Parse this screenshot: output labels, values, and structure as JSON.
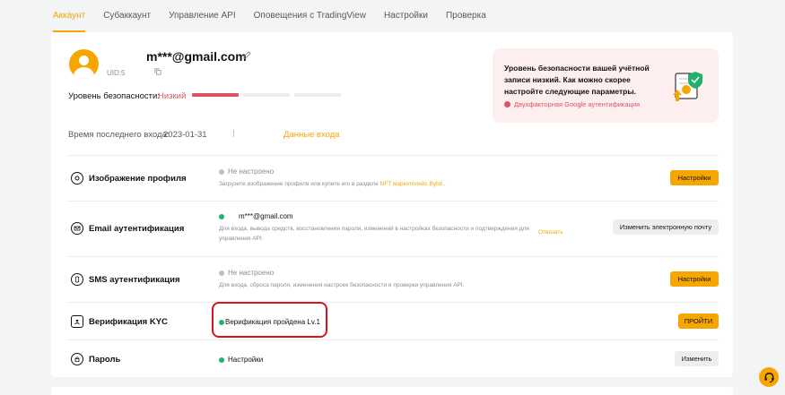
{
  "tabs": [
    {
      "label": "Аккаунт",
      "active": true
    },
    {
      "label": "Субаккаунт",
      "active": false
    },
    {
      "label": "Управление API",
      "active": false
    },
    {
      "label": "Оповещения с TradingView",
      "active": false
    },
    {
      "label": "Настройки",
      "active": false
    },
    {
      "label": "Проверка",
      "active": false
    }
  ],
  "profile": {
    "email": "m***@gmail.com",
    "uid": "UID:5",
    "security_label": "Уровень безопасности:",
    "security_value": "Низкий",
    "security_level_filled": 1,
    "security_level_total": 3,
    "last_login_label": "Время последнего входа:",
    "last_login_date": "2023-01-31",
    "login_data_link": "Данные входа"
  },
  "alert": {
    "text": "Уровень безопасности вашей учётной записи низкий. Как можно скорее настройте следующие параметры.",
    "link": "Двухфакторная Google аутентификация"
  },
  "rows": [
    {
      "title": "Изображение профиля",
      "icon": "profile-image-icon",
      "status": "Не настроено",
      "status_ok": false,
      "desc_prefix": "Загрузите изображение профиля или купите его в разделе ",
      "desc_link": "NFT маркетплейс Bybit",
      "desc_suffix": " .",
      "button": "Настройки"
    },
    {
      "title": "Email аутентификация",
      "icon": "email-icon",
      "status": "m***@gmail.com",
      "status_ok": true,
      "desc": "Для входа, вывода средств, восстановления пароля, изменений в настройках безопасности и подтверждения для управления API.",
      "rebind": "Отвязать",
      "button": "Изменить электронную почту"
    },
    {
      "title": "SMS аутентификация",
      "icon": "sms-icon",
      "status": "Не настроено",
      "status_ok": false,
      "desc": "Для входа, сброса пароля, изменения настроек безопасности и проверки управления API.",
      "button": "Настройки"
    },
    {
      "title": "Верификация KYC",
      "icon": "kyc-icon",
      "status": "Верификация пройдена Lv.1",
      "status_ok": true,
      "button": "ПРОЙТИ"
    },
    {
      "title": "Пароль",
      "icon": "password-icon",
      "status": "Настройки",
      "status_ok": true,
      "button": "Изменить"
    }
  ],
  "colors": {
    "accent": "#f7a600",
    "danger": "#e05261",
    "success": "#20b26c",
    "highlight": "#d9141e"
  }
}
